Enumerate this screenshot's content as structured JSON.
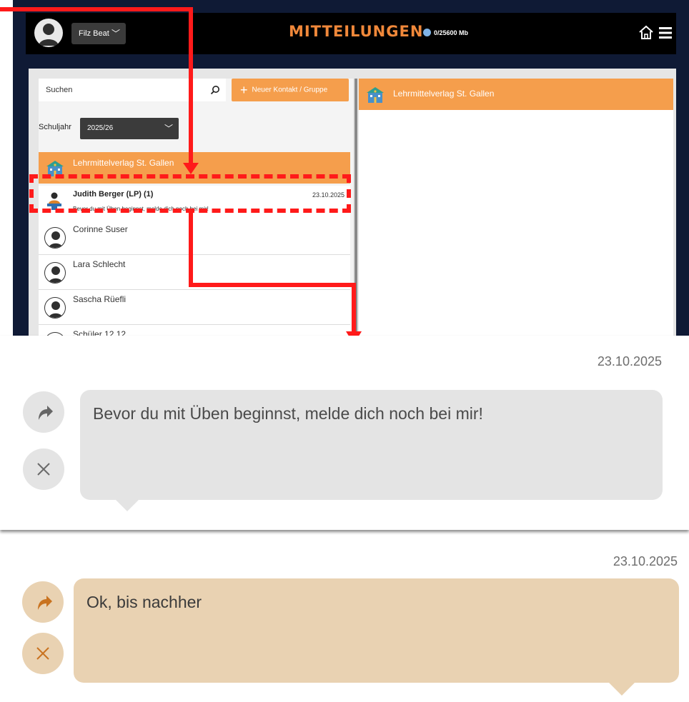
{
  "header": {
    "user_name": "Filz Beat",
    "title": "MITTEILUNGEN",
    "storage": "0/25600 Mb"
  },
  "left": {
    "search_placeholder": "Suchen",
    "new_contact_label": "Neuer Kontakt / Gruppe",
    "school_year_label": "Schuljahr",
    "school_year_value": "2025/26",
    "org_name": "Lehrmittelverlag St. Gallen",
    "selected": {
      "name": "Judith Berger (LP) (1)",
      "date": "23.10.2025",
      "message": "Bevor du mit Üben beginnst, melde dich noch bei mir!"
    },
    "contacts": [
      "Corinne Suser",
      "Lara Schlecht",
      "Sascha Rüefli",
      "Schüler 12.12"
    ]
  },
  "right": {
    "org_name": "Lehrmittelverlag St. Gallen"
  },
  "zoom_incoming": {
    "date": "23.10.2025",
    "message": "Bevor du mit Üben beginnst, melde dich noch bei mir!"
  },
  "zoom_reply": {
    "date": "23.10.2025",
    "message": "Ok, bis nachher"
  },
  "colors": {
    "accent_orange": "#f59e4c",
    "title_orange": "#f0883a",
    "highlight_red": "#ff1a1a",
    "reply_bubble": "#e9d2b2",
    "incoming_bubble": "#e4e4e4"
  }
}
